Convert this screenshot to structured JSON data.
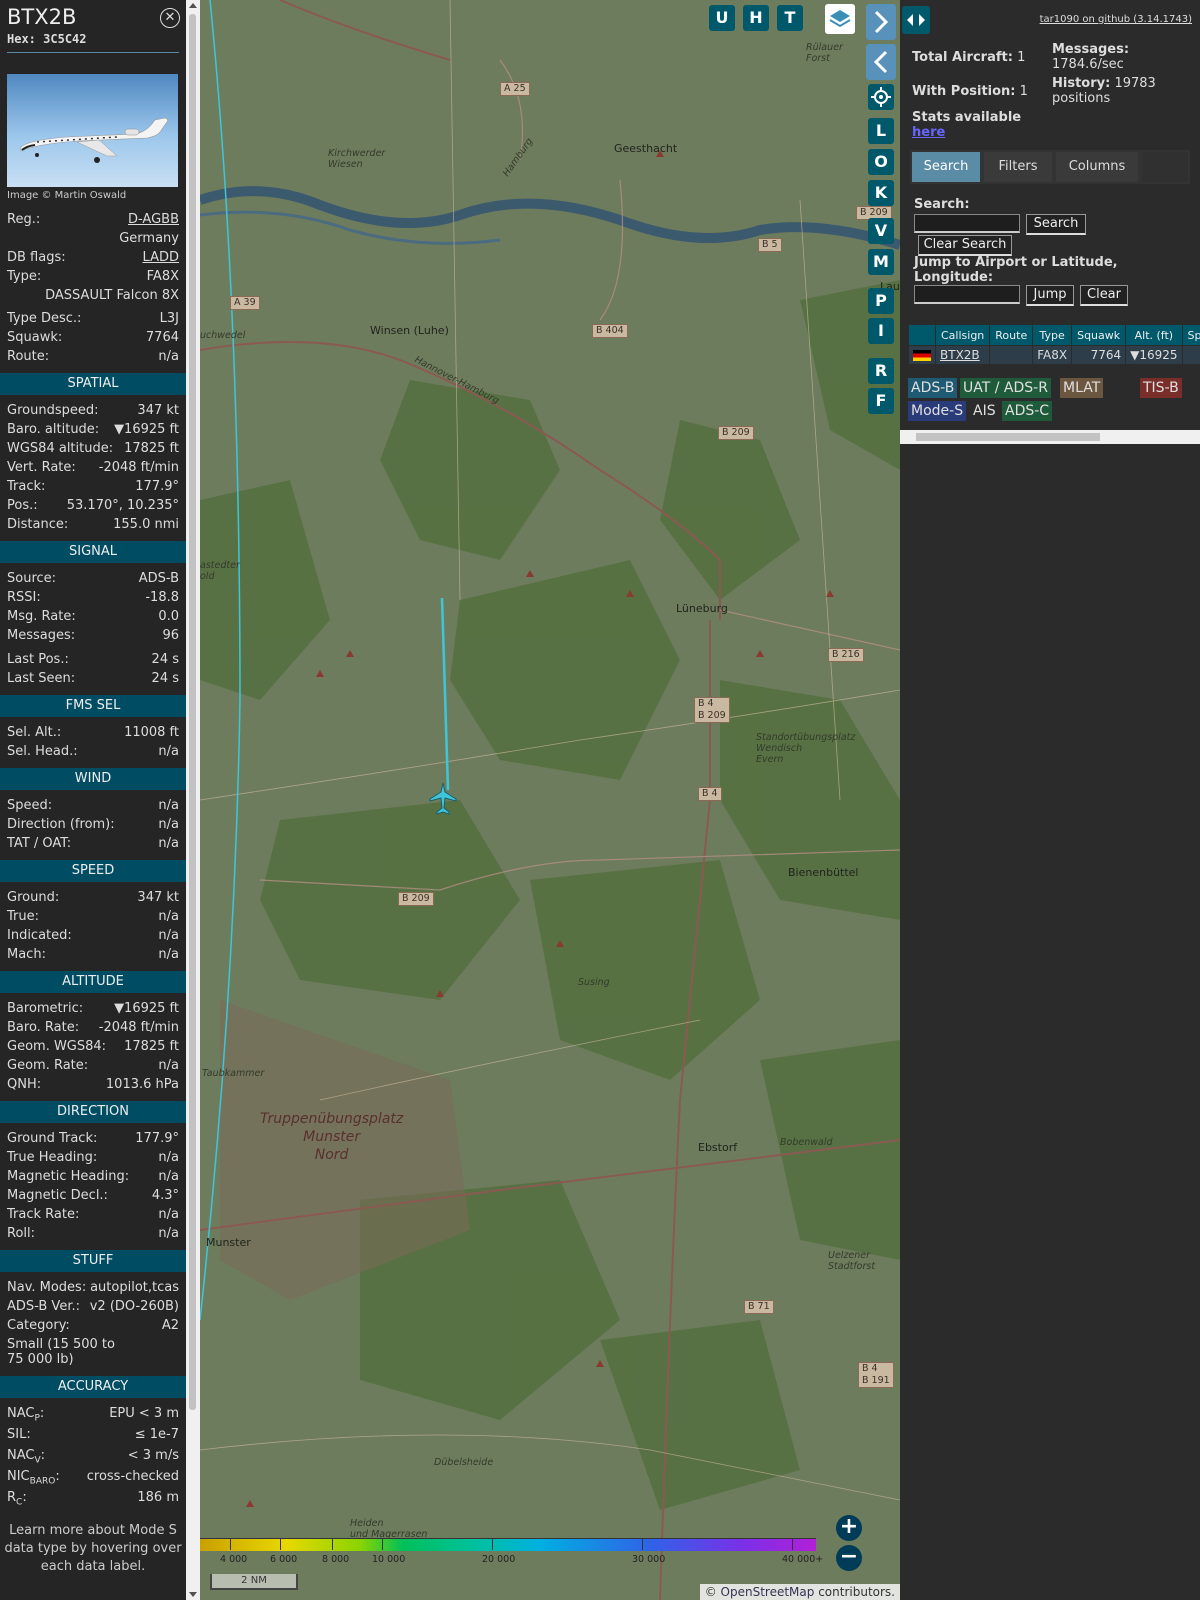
{
  "info": {
    "callsign": "BTX2B",
    "hex_label": "Hex:",
    "hex": "3C5C42",
    "photo_credit": "Image © Martin Oswald",
    "header_rows": [
      {
        "label": "Reg.:",
        "value": "D-AGBB",
        "link": true
      },
      {
        "label": "",
        "value": "Germany",
        "link": false
      },
      {
        "label": "DB flags:",
        "value": "LADD",
        "link": true
      },
      {
        "label": "Type:",
        "value": "FA8X",
        "link": false
      },
      {
        "label": "",
        "value": "DASSAULT Falcon 8X",
        "link": false
      }
    ],
    "header_rows2": [
      {
        "label": "Type Desc.:",
        "value": "L3J"
      },
      {
        "label": "Squawk:",
        "value": "7764"
      },
      {
        "label": "Route:",
        "value": "n/a"
      }
    ],
    "sections": [
      {
        "title": "SPATIAL",
        "rows": [
          {
            "label": "Groundspeed:",
            "value": "347 kt"
          },
          {
            "label": "Baro. altitude:",
            "value": "▼16925 ft"
          },
          {
            "label": "WGS84 altitude:",
            "value": "17825 ft"
          },
          {
            "label": "Vert. Rate:",
            "value": "-2048 ft/min"
          },
          {
            "label": "Track:",
            "value": "177.9°"
          },
          {
            "label": "Pos.:",
            "value": "53.170°, 10.235°"
          },
          {
            "label": "Distance:",
            "value": "155.0 nmi"
          }
        ]
      },
      {
        "title": "SIGNAL",
        "rows": [
          {
            "label": "Source:",
            "value": "ADS-B"
          },
          {
            "label": "RSSI:",
            "value": "-18.8"
          },
          {
            "label": "Msg. Rate:",
            "value": "0.0"
          },
          {
            "label": "Messages:",
            "value": "96"
          },
          {
            "label": "Last Pos.:",
            "value": "24 s"
          },
          {
            "label": "Last Seen:",
            "value": "24 s"
          }
        ]
      },
      {
        "title": "FMS SEL",
        "rows": [
          {
            "label": "Sel. Alt.:",
            "value": "11008 ft"
          },
          {
            "label": "Sel. Head.:",
            "value": "n/a"
          }
        ]
      },
      {
        "title": "WIND",
        "rows": [
          {
            "label": "Speed:",
            "value": "n/a"
          },
          {
            "label": "Direction (from):",
            "value": "n/a"
          },
          {
            "label": "TAT / OAT:",
            "value": "n/a"
          }
        ]
      },
      {
        "title": "SPEED",
        "rows": [
          {
            "label": "Ground:",
            "value": "347 kt"
          },
          {
            "label": "True:",
            "value": "n/a"
          },
          {
            "label": "Indicated:",
            "value": "n/a"
          },
          {
            "label": "Mach:",
            "value": "n/a"
          }
        ]
      },
      {
        "title": "ALTITUDE",
        "rows": [
          {
            "label": "Barometric:",
            "value": "▼16925 ft"
          },
          {
            "label": "Baro. Rate:",
            "value": "-2048 ft/min"
          },
          {
            "label": "Geom. WGS84:",
            "value": "17825 ft"
          },
          {
            "label": "Geom. Rate:",
            "value": "n/a"
          },
          {
            "label": "QNH:",
            "value": "1013.6 hPa"
          }
        ]
      },
      {
        "title": "DIRECTION",
        "rows": [
          {
            "label": "Ground Track:",
            "value": "177.9°"
          },
          {
            "label": "True Heading:",
            "value": "n/a"
          },
          {
            "label": "Magnetic Heading:",
            "value": "n/a"
          },
          {
            "label": "Magnetic Decl.:",
            "value": "4.3°"
          },
          {
            "label": "Track Rate:",
            "value": "n/a"
          },
          {
            "label": "Roll:",
            "value": "n/a"
          }
        ]
      },
      {
        "title": "STUFF",
        "rows": [
          {
            "label": "Nav. Modes:",
            "value": "autopilot,tcas"
          },
          {
            "label": "ADS-B Ver.:",
            "value": "v2 (DO-260B)"
          },
          {
            "label": "Category:",
            "value": "A2"
          }
        ]
      }
    ],
    "category_desc": "Small (15 500 to 75 000 lb)",
    "accuracy_title": "ACCURACY",
    "accuracy_rows": [
      {
        "label": "NAC",
        "sub": "P",
        "suffix": ":",
        "value": "EPU < 3 m"
      },
      {
        "label": "SIL:",
        "sub": "",
        "suffix": "",
        "value": "≤ 1e-7"
      },
      {
        "label": "NAC",
        "sub": "V",
        "suffix": ":",
        "value": "< 3 m/s"
      },
      {
        "label": "NIC",
        "sub": "BARO",
        "suffix": ":",
        "value": "cross-checked"
      },
      {
        "label": "R",
        "sub": "C",
        "suffix": ":",
        "value": "186 m"
      }
    ],
    "footer": "Learn more about Mode S data type by hovering over each data label."
  },
  "map": {
    "top_buttons": [
      "U",
      "H",
      "T"
    ],
    "side_buttons": [
      "L",
      "O",
      "K",
      "V",
      "M",
      "P",
      "I",
      "R",
      "F"
    ],
    "shields": [
      {
        "text": "A 25"
      },
      {
        "text": "A 39"
      },
      {
        "text": "B 404"
      },
      {
        "text": "B 5"
      },
      {
        "text": "B 209"
      },
      {
        "text": "B 4\nB 209"
      },
      {
        "text": "B 216"
      },
      {
        "text": "B 4"
      },
      {
        "text": "B 209"
      },
      {
        "text": "B 71"
      },
      {
        "text": "B 4\nB 191"
      },
      {
        "text": "B 209"
      }
    ],
    "places": [
      {
        "text": "Geesthacht",
        "style": ""
      },
      {
        "text": "Winsen (Luhe)",
        "style": ""
      },
      {
        "text": "Lüneburg",
        "style": ""
      },
      {
        "text": "Bienenbüttel",
        "style": ""
      },
      {
        "text": "Ebstorf",
        "style": ""
      },
      {
        "text": "Munster",
        "style": ""
      },
      {
        "text": "Kirchwerder\nWiesen",
        "style": "italic"
      },
      {
        "text": "Rülauer\nForst",
        "style": "italic"
      },
      {
        "text": "Standortübungsplatz\nWendisch\nEvern",
        "style": "italic"
      },
      {
        "text": "Susing",
        "style": "italic"
      },
      {
        "text": "Bobenwald",
        "style": "italic"
      },
      {
        "text": "Uelzener\nStadtforst",
        "style": "italic"
      },
      {
        "text": "Dübelsheide",
        "style": "italic"
      },
      {
        "text": "Heiden\nund Magerrasen",
        "style": "italic"
      },
      {
        "text": "Truppenübungsplatz\nMunster\nNord",
        "style": "big"
      },
      {
        "text": "Hamburg",
        "style": "italic"
      },
      {
        "text": "Hannover-Hamburg",
        "style": "italic"
      },
      {
        "text": "uchwedel",
        "style": "italic"
      },
      {
        "text": "astedter\nold",
        "style": "italic"
      },
      {
        "text": "Taubkammer",
        "style": "italic"
      },
      {
        "text": "Lau",
        "style": ""
      }
    ],
    "legend_labels": [
      "4 000",
      "6 000",
      "8 000",
      "10 000",
      "20 000",
      "30 000",
      "40 000+"
    ],
    "scale": "2 NM",
    "attribution_prefix": "© ",
    "attribution_link": "OpenStreetMap",
    "attribution_suffix": " contributors."
  },
  "sidebar": {
    "github": "tar1090 on github (3.14.1743)",
    "total_aircraft_label": "Total Aircraft:",
    "total_aircraft": "1",
    "with_position_label": "With Position:",
    "with_position": "1",
    "messages_label": "Messages:",
    "messages": "1784.6/sec",
    "history_label": "History:",
    "history": "19783 positions",
    "stats_label": "Stats available",
    "stats_link": "here",
    "tabs": [
      "Search",
      "Filters",
      "Columns"
    ],
    "search_label": "Search:",
    "search_btn": "Search",
    "clear_search_btn": "Clear Search",
    "jump_label": "Jump to Airport or Latitude, Longitude:",
    "jump_btn": "Jump",
    "clear_btn": "Clear",
    "table_headers": [
      "Callsign",
      "Route",
      "Type",
      "Squawk",
      "Alt. (ft)",
      "Spd"
    ],
    "table_rows": [
      {
        "callsign": "BTX2B",
        "route": "",
        "type": "FA8X",
        "squawk": "7764",
        "alt": "▼16925",
        "spd": ""
      }
    ],
    "sources": [
      {
        "label": "ADS-B",
        "bg": "#1e5a72",
        "fg": "#e0e0e0"
      },
      {
        "label": "UAT / ADS-R",
        "bg": "#1f5a3a",
        "fg": "#e0e0e0"
      },
      {
        "label": "MLAT",
        "bg": "#6b5640",
        "fg": "#e0e0e0"
      },
      {
        "label": "TIS-B",
        "bg": "#7a2e2a",
        "fg": "#e0e0e0"
      },
      {
        "label": "Mode-S",
        "bg": "#2a3b7a",
        "fg": "#e0e0e0"
      },
      {
        "label": "AIS",
        "bg": "#2b2b2b",
        "fg": "#e0e0e0"
      },
      {
        "label": "ADS-C",
        "bg": "#1f5a3a",
        "fg": "#e0e0e0"
      }
    ]
  },
  "colors": {
    "accent": "#00596b",
    "section": "#004c63",
    "track": "#3ec6d8"
  }
}
